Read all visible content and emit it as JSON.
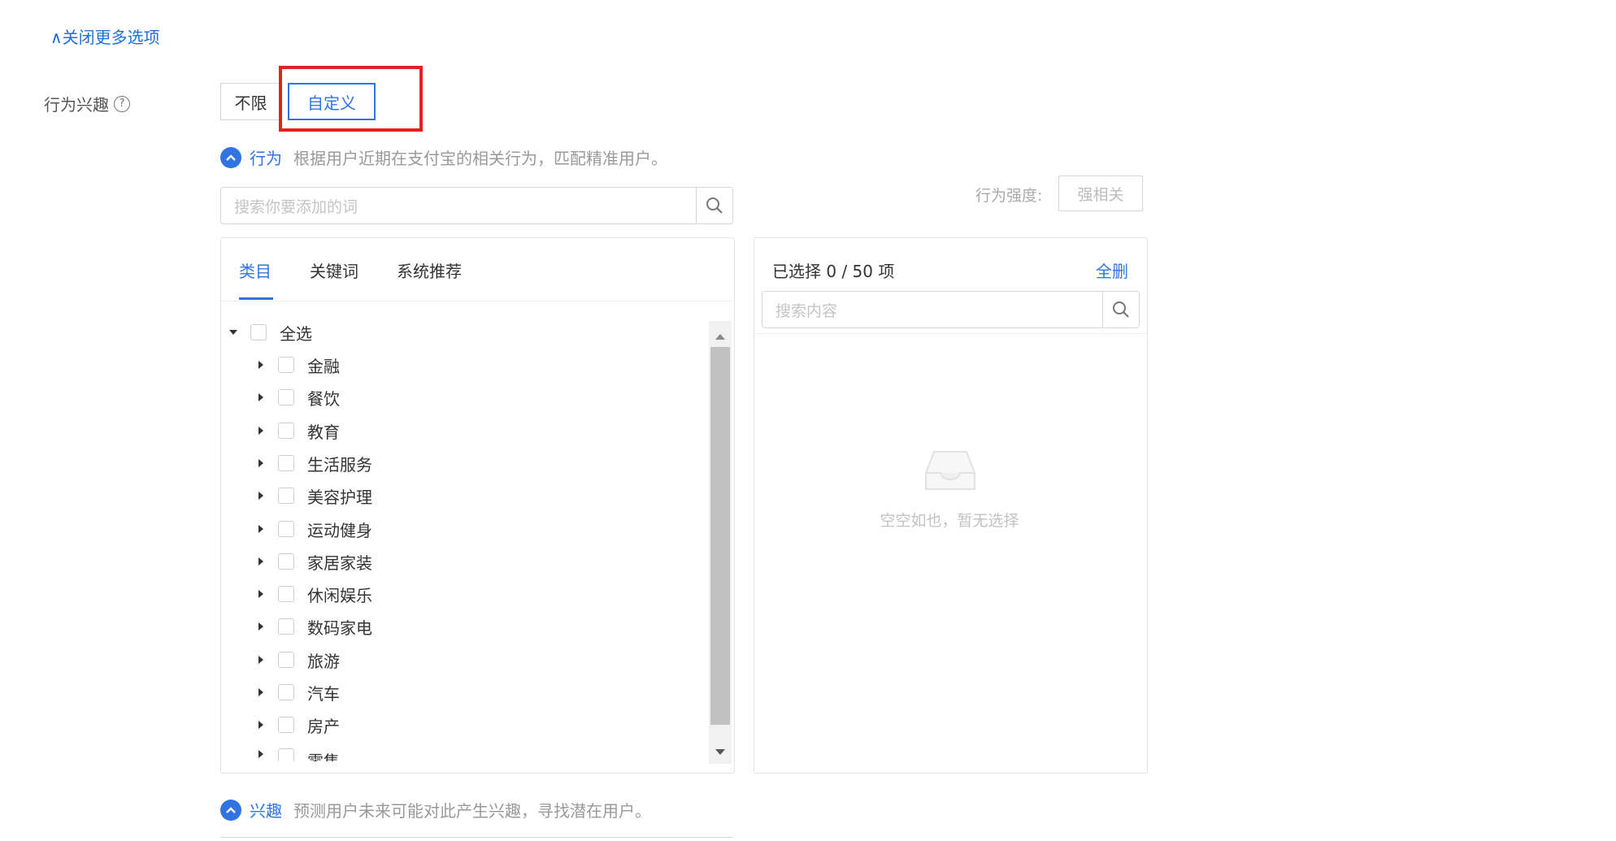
{
  "collapse_link": "∧关闭更多选项",
  "field": {
    "label": "行为兴趣",
    "help_icon": "question-circle-icon"
  },
  "segmented": {
    "option_any": "不限",
    "option_custom": "自定义",
    "selected": "自定义"
  },
  "behavior_section": {
    "title": "行为",
    "description": "根据用户近期在支付宝的相关行为，匹配精准用户。",
    "search_placeholder": "搜索你要添加的词",
    "strength_label": "行为强度:",
    "strength_value": "强相关"
  },
  "tabs": [
    "类目",
    "关键词",
    "系统推荐"
  ],
  "active_tab": "类目",
  "tree": {
    "select_all": "全选",
    "items": [
      "金融",
      "餐饮",
      "教育",
      "生活服务",
      "美容护理",
      "运动健身",
      "家居家装",
      "休闲娱乐",
      "数码家电",
      "旅游",
      "汽车",
      "房产",
      "零售"
    ]
  },
  "selected_panel": {
    "header": "已选择 0 / 50 项",
    "clear_all": "全删",
    "search_placeholder": "搜索内容",
    "empty_text": "空空如也，暂无选择"
  },
  "interest_section": {
    "title": "兴趣",
    "description": "预测用户未来可能对此产生兴趣，寻找潜在用户。"
  },
  "colors": {
    "accent": "#2f74e0",
    "highlight": "#e32121"
  }
}
